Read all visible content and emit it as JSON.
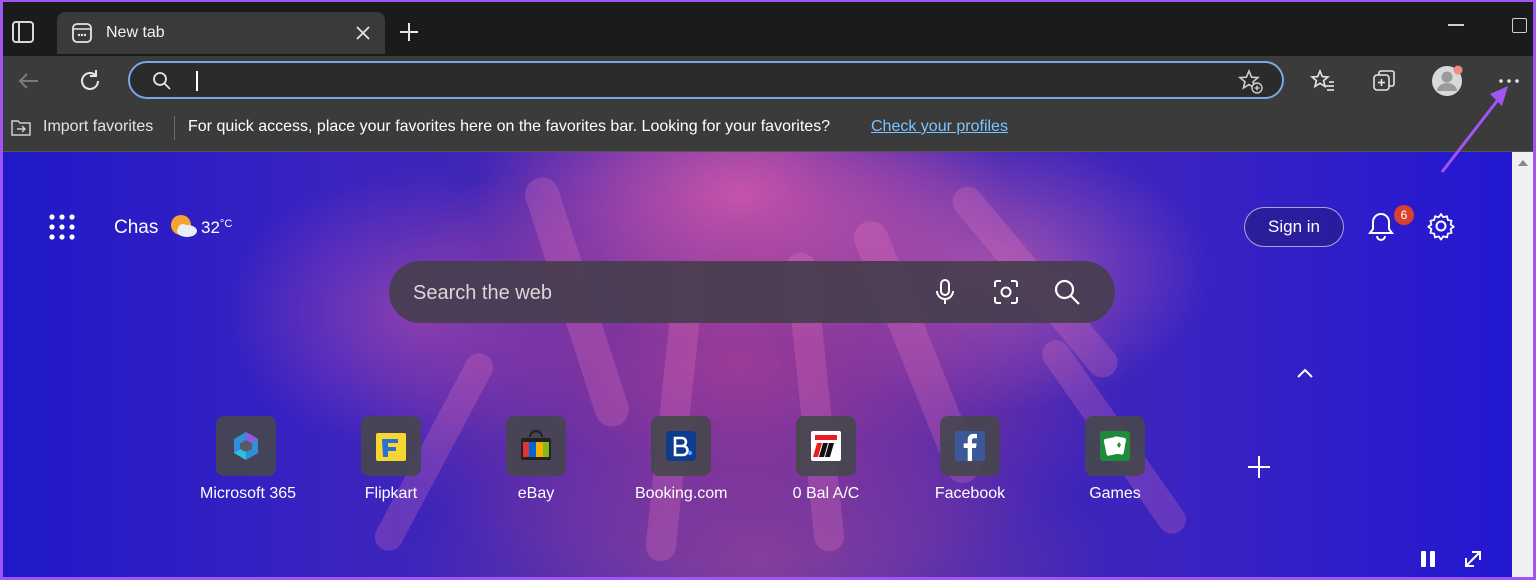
{
  "browser": {
    "tab": {
      "title": "New tab"
    },
    "address": {
      "value": "",
      "placeholder": ""
    }
  },
  "favorites_bar": {
    "import_label": "Import favorites",
    "message": "For quick access, place your favorites here on the favorites bar. Looking for your favorites?",
    "link": "Check your profiles"
  },
  "ntp": {
    "location": "Chas",
    "temperature": "32",
    "temperature_unit": "°C",
    "signin_label": "Sign in",
    "notification_count": "6",
    "search_placeholder": "Search the web",
    "tiles": [
      {
        "label": "Microsoft 365",
        "icon": "microsoft-365-icon"
      },
      {
        "label": "Flipkart",
        "icon": "flipkart-icon"
      },
      {
        "label": "eBay",
        "icon": "ebay-icon"
      },
      {
        "label": "Booking.com",
        "icon": "booking-icon"
      },
      {
        "label": "0 Bal A/C",
        "icon": "kotak-icon"
      },
      {
        "label": "Facebook",
        "icon": "facebook-icon"
      },
      {
        "label": "Games",
        "icon": "games-icon"
      }
    ]
  },
  "colors": {
    "accent_highlight": "#a155f2",
    "address_focus": "#7aa7e6",
    "link": "#7cc4ff",
    "badge": "#d8412f"
  }
}
